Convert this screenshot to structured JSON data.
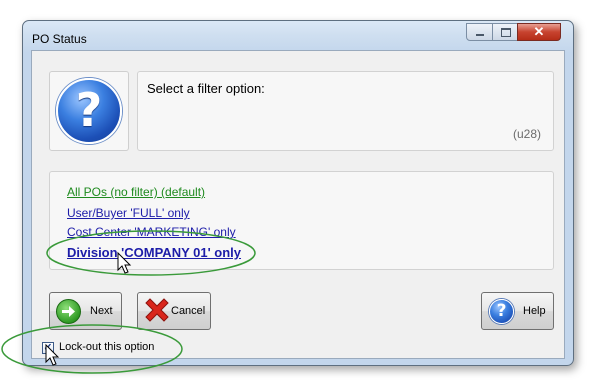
{
  "window": {
    "title": "PO Status",
    "controls": {
      "minimize_icon": "minimize-icon",
      "maximize_icon": "maximize-icon",
      "close_glyph": "✕"
    }
  },
  "message": {
    "icon": "question-icon",
    "icon_glyph": "?",
    "text": "Select a filter option:",
    "code": "(u28)"
  },
  "options": [
    {
      "label": "All POs (no filter) (default)",
      "color": "#1e8a1e"
    },
    {
      "label": "User/Buyer 'FULL' only",
      "color": "#1c1ca8"
    },
    {
      "label": "Cost Center 'MARKETING' only",
      "color": "#1c1ca8"
    },
    {
      "label": "Division 'COMPANY 01' only",
      "color": "#1c1ca8",
      "highlighted": true
    }
  ],
  "buttons": {
    "next": {
      "label": "Next",
      "icon": "green-arrow-right-icon"
    },
    "cancel": {
      "label": "Cancel",
      "icon": "red-x-icon"
    },
    "help": {
      "label": "Help",
      "icon": "question-icon",
      "icon_glyph": "?"
    }
  },
  "lock_option": {
    "label": "Lock-out this option",
    "checked": true,
    "check_glyph": "✓"
  },
  "annotation": {
    "ellipse_color": "#3a9a3a"
  }
}
